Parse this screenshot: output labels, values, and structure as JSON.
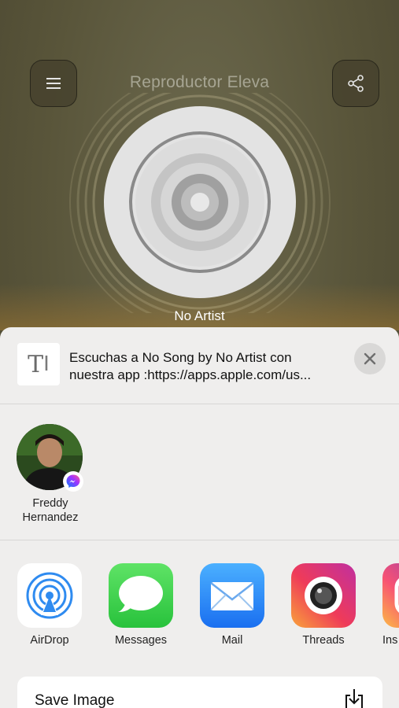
{
  "player": {
    "title": "Reproductor Eleva",
    "artist": "No Artist"
  },
  "share_sheet": {
    "preview_line1": "Escuchas a No Song by No Artist con",
    "preview_line2": "nuestra app :https://apps.apple.com/us...",
    "thumb_glyph": "T",
    "contact": {
      "name_line1": "Freddy",
      "name_line2": "Hernandez",
      "badge_icon": "messenger-icon"
    },
    "apps": [
      {
        "label": "AirDrop",
        "icon": "airdrop-icon"
      },
      {
        "label": "Messages",
        "icon": "messages-icon"
      },
      {
        "label": "Mail",
        "icon": "mail-icon"
      },
      {
        "label": "Threads",
        "icon": "threads-icon"
      },
      {
        "label": "Ins",
        "icon": "instagram-icon"
      }
    ],
    "action": {
      "label": "Save Image",
      "icon": "save-download-icon"
    }
  },
  "colors": {
    "background": "#59553a",
    "sheet": "#efeeed",
    "messages_green": "#34c759",
    "mail_blue": "#1f8bf5"
  }
}
